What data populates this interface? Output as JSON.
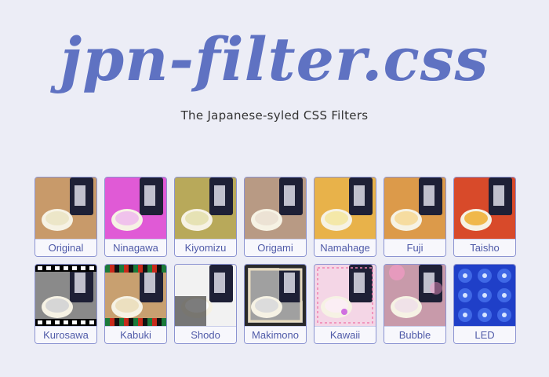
{
  "header": {
    "title": "jpn-filter.css",
    "subtitle": "The Japanese-syled CSS Filters"
  },
  "filters": [
    {
      "label": "Original",
      "tint": "#c89a6a",
      "cup": "#ece6c8",
      "mode": "normal"
    },
    {
      "label": "Ninagawa",
      "tint": "#e05ad6",
      "cup": "#f0c2ec",
      "mode": "normal"
    },
    {
      "label": "Kiyomizu",
      "tint": "#b8a95a",
      "cup": "#e6e2b4",
      "mode": "normal"
    },
    {
      "label": "Origami",
      "tint": "#b89a84",
      "cup": "#ece2d4",
      "mode": "normal"
    },
    {
      "label": "Namahage",
      "tint": "#e8b24a",
      "cup": "#f4e8a8",
      "mode": "normal"
    },
    {
      "label": "Fuji",
      "tint": "#dc9a4a",
      "cup": "#f6dca0",
      "mode": "normal"
    },
    {
      "label": "Taisho",
      "tint": "#d84a2a",
      "cup": "#f0b84a",
      "mode": "normal"
    },
    {
      "label": "Kurosawa",
      "tint": "#8a8a8a",
      "cup": "#d6d6d6",
      "mode": "film"
    },
    {
      "label": "Kabuki",
      "tint": "#c8a070",
      "cup": "#ece0c0",
      "mode": "stripes"
    },
    {
      "label": "Shodo",
      "tint": "#f2f2f2",
      "cup": "#ffffff",
      "mode": "ink"
    },
    {
      "label": "Makimono",
      "tint": "#a0a0a0",
      "cup": "#dcdcdc",
      "mode": "scroll"
    },
    {
      "label": "Kawaii",
      "tint": "#f4d6e6",
      "cup": "#fbeef4",
      "mode": "kawaii"
    },
    {
      "label": "Bubble",
      "tint": "#c89aaa",
      "cup": "#f0e2e8",
      "mode": "bubble"
    },
    {
      "label": "LED",
      "tint": "#1f3fc8",
      "cup": "#3a6ae8",
      "mode": "led"
    }
  ]
}
